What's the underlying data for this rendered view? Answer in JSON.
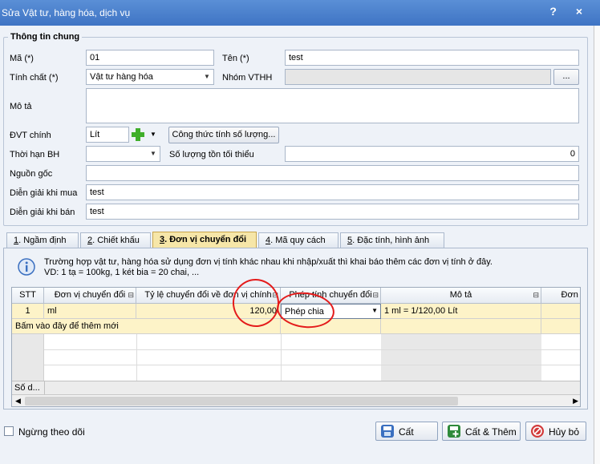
{
  "window": {
    "title": "Sửa Vật tư, hàng hóa, dịch vụ",
    "help": "?",
    "close": "×"
  },
  "group": {
    "title": "Thông tin chung"
  },
  "form": {
    "ma_label": "Mã (*)",
    "ma_value": "01",
    "ten_label": "Tên (*)",
    "ten_value": "test",
    "tinhchat_label": "Tính chất (*)",
    "tinhchat_value": "Vật tư hàng hóa",
    "nhom_label": "Nhóm VTHH",
    "nhom_value": "",
    "nhom_btn": "...",
    "mota_label": "Mô tả",
    "mota_value": "",
    "dvt_label": "ĐVT chính",
    "dvt_value": "Lít",
    "congthuc_btn": "Công thức tính số lượng...",
    "thoihan_label": "Thời hạn BH",
    "thoihan_value": "",
    "soluongton_label": "Số lượng tồn tối thiểu",
    "soluongton_value": "0",
    "nguongoc_label": "Nguồn gốc",
    "nguongoc_value": "",
    "diengiaimua_label": "Diễn giải khi mua",
    "diengiaimua_value": "test",
    "diengiaiban_label": "Diễn giải khi bán",
    "diengiaiban_value": "test"
  },
  "tabs": [
    {
      "key": "1",
      "label": ". Ngầm định"
    },
    {
      "key": "2",
      "label": ". Chiết khấu"
    },
    {
      "key": "3",
      "label": ". Đơn vị chuyển đổi"
    },
    {
      "key": "4",
      "label": ". Mã quy cách"
    },
    {
      "key": "5",
      "label": ". Đặc tính, hình ảnh"
    }
  ],
  "info": {
    "line1": "Trường hợp vật tư, hàng hóa sử dụng đơn vị tính khác nhau khi nhập/xuất thì khai báo thêm các đơn vị tính ở đây.",
    "line2": "VD: 1 tạ = 100kg, 1 két bia = 20 chai, ..."
  },
  "grid": {
    "columns": [
      "STT",
      "Đơn vị chuyển đổi",
      "Tỷ lệ chuyển đổi về đơn vị chính",
      "Phép tính chuyển đổi",
      "Mô tả",
      "Đơn g"
    ],
    "rows": [
      {
        "stt": "1",
        "donvi": "ml",
        "tyle": "120,00",
        "pheptinh": "Phép chia",
        "mota": "1 ml = 1/120,00 Lít"
      }
    ],
    "add_hint": "Bấm vào đây để thêm mới",
    "footer": "Số d..."
  },
  "footer": {
    "ngung_label": "Ngừng theo dõi",
    "cat_btn": "Cất",
    "catthem_btn": "Cất & Thêm",
    "huybo_btn": "Hủy bỏ"
  },
  "colors": {
    "title_bar": "#4a82cf",
    "active_tab": "#f6e6a8",
    "selected_row": "#fdf3c8",
    "annotation": "#e41b1b"
  }
}
